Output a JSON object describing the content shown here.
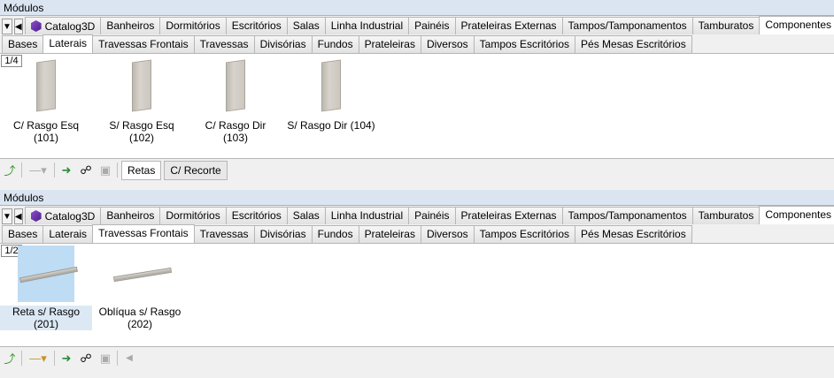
{
  "top": {
    "title": "Módulos",
    "catalog_label": "Catalog3D",
    "categories": [
      "Banheiros",
      "Dormitórios",
      "Escritórios",
      "Salas",
      "Linha Industrial",
      "Painéis",
      "Prateleiras Externas",
      "Tampos/Tamponamentos",
      "Tamburatos",
      "Componentes"
    ],
    "active_category": "Componentes",
    "subtabs": [
      "Bases",
      "Laterais",
      "Travessas Frontais",
      "Travessas",
      "Divisórias",
      "Fundos",
      "Prateleiras",
      "Diversos",
      "Tampos Escritórios",
      "Pés Mesas Escritórios"
    ],
    "active_subtab": "Laterais",
    "page": "1/4",
    "items": [
      {
        "label": "C/ Rasgo Esq (101)"
      },
      {
        "label": "S/ Rasgo Esq (102)"
      },
      {
        "label": "C/ Rasgo Dir (103)"
      },
      {
        "label": "S/ Rasgo Dir (104)"
      }
    ],
    "bottom_tabs": [
      "Retas",
      "C/ Recorte"
    ]
  },
  "bottom": {
    "title": "Módulos",
    "catalog_label": "Catalog3D",
    "categories": [
      "Banheiros",
      "Dormitórios",
      "Escritórios",
      "Salas",
      "Linha Industrial",
      "Painéis",
      "Prateleiras Externas",
      "Tampos/Tamponamentos",
      "Tamburatos",
      "Componentes"
    ],
    "active_category": "Componentes",
    "subtabs": [
      "Bases",
      "Laterais",
      "Travessas Frontais",
      "Travessas",
      "Divisórias",
      "Fundos",
      "Prateleiras",
      "Diversos",
      "Tampos Escritórios",
      "Pés Mesas Escritórios"
    ],
    "active_subtab": "Travessas Frontais",
    "page": "1/2",
    "items": [
      {
        "label": "Reta s/ Rasgo (201)",
        "selected": true
      },
      {
        "label": "Oblíqua s/ Rasgo (202)",
        "selected": false
      }
    ]
  },
  "icons": {
    "dropdown": "chevron-down-icon",
    "back": "chevron-left-icon",
    "catalog": "purple-cube-icon",
    "refresh": "green-arrow-tree-icon",
    "line_style": "line-style-icon",
    "insert": "green-arrow-right-icon",
    "find": "binoculars-icon",
    "lock": "lock-icon"
  }
}
